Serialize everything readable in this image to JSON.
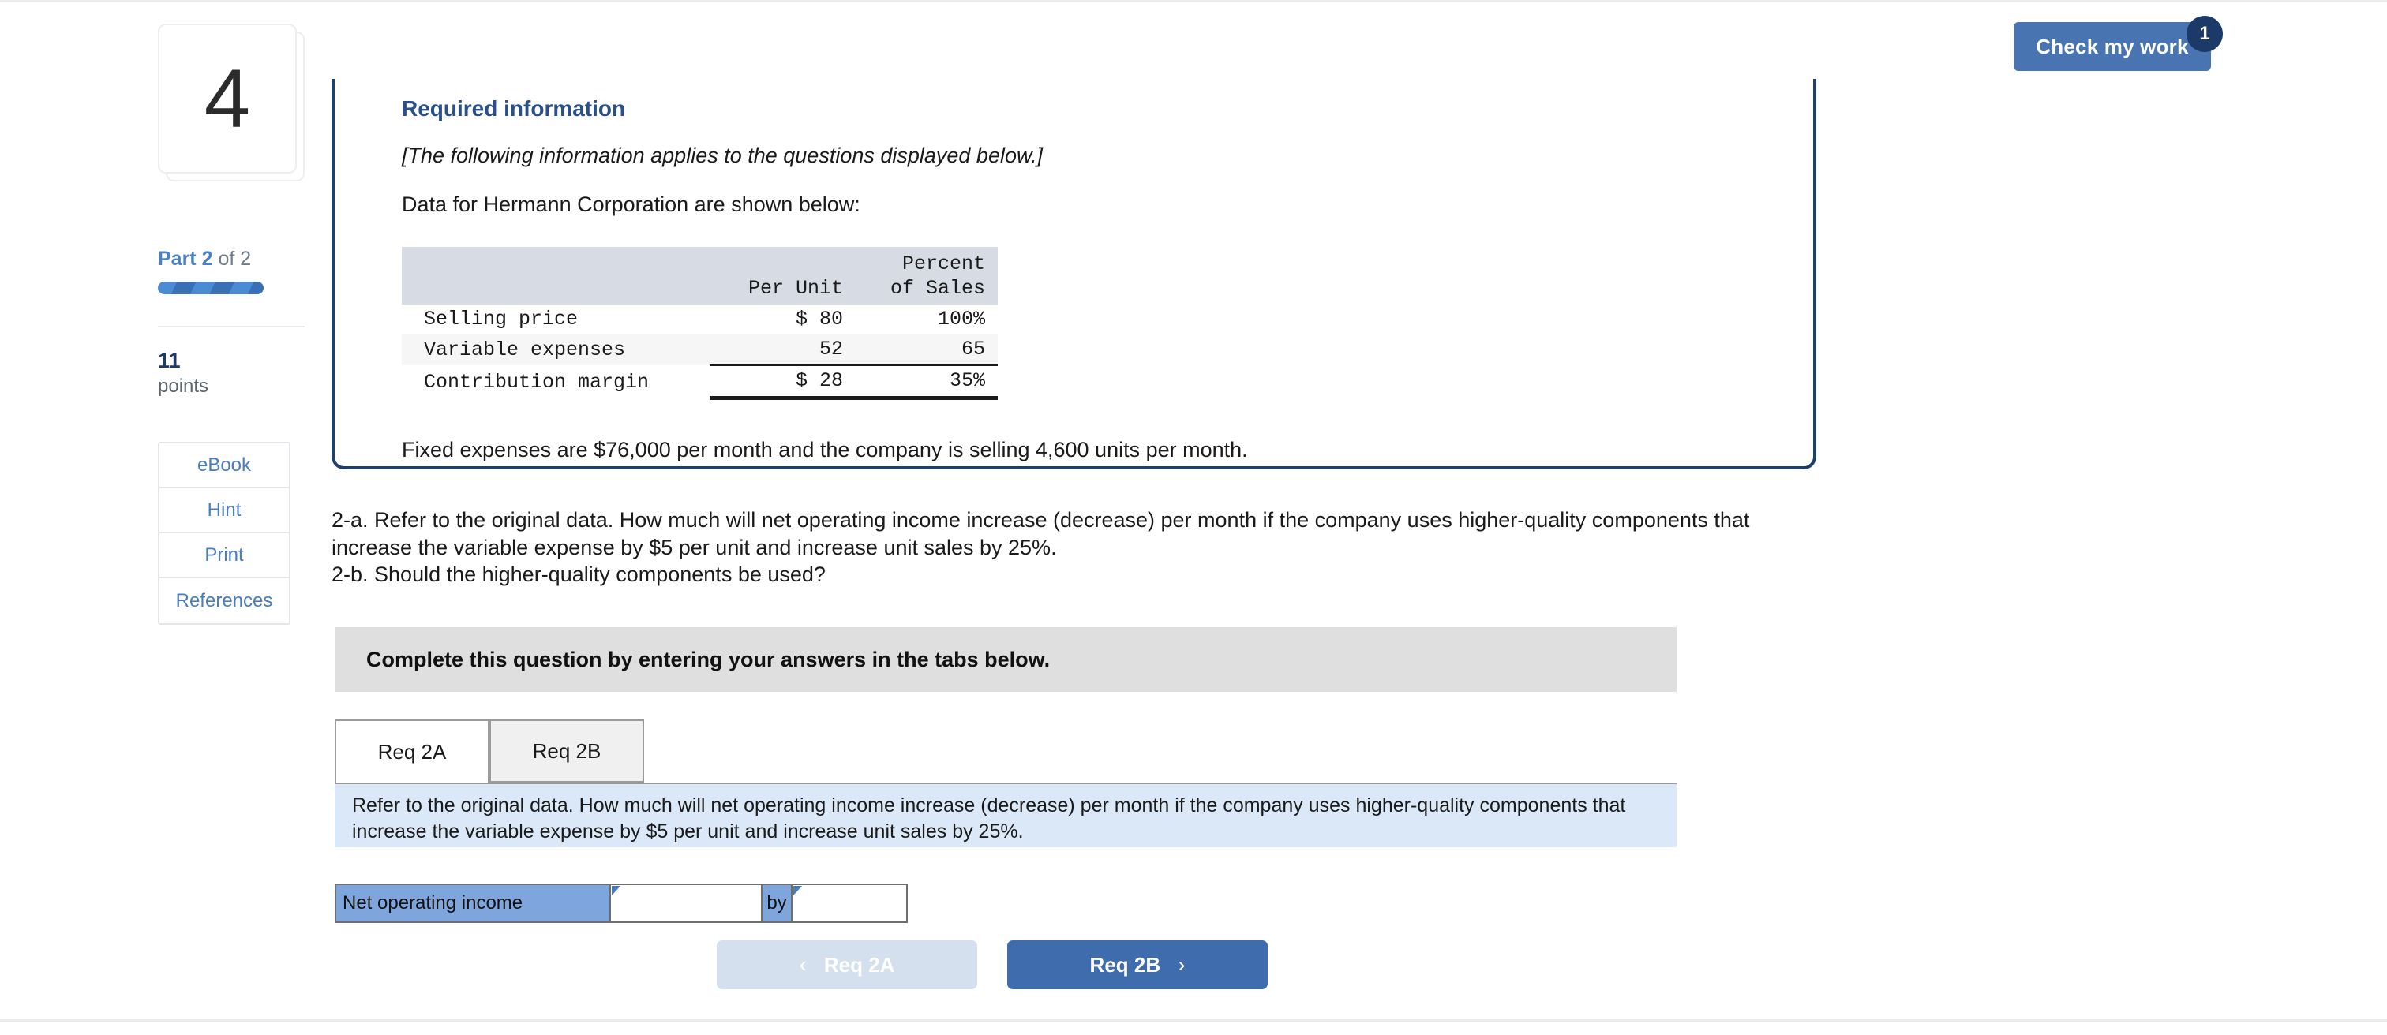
{
  "header": {
    "check_my_work_label": "Check my work",
    "check_my_work_badge": "1"
  },
  "sidebar": {
    "question_number": "4",
    "part_prefix": "Part ",
    "part_current": "2",
    "part_suffix": " of 2",
    "points_value": "11",
    "points_label": "points",
    "tools": [
      {
        "label": "eBook"
      },
      {
        "label": "Hint"
      },
      {
        "label": "Print"
      },
      {
        "label": "References"
      }
    ]
  },
  "required_info": {
    "title": "Required information",
    "italic_note": "[The following information applies to the questions displayed below.]",
    "data_intro": "Data for Hermann Corporation are shown below:",
    "fixed_expenses": "Fixed expenses are $76,000 per month and the company is selling 4,600 units per month."
  },
  "table": {
    "header_line1_col2": "",
    "header_line1_col3": "Percent",
    "header_line2_col1": "",
    "header_line2_col2": "Per Unit",
    "header_line2_col3": "of Sales",
    "rows": [
      {
        "label": "Selling price",
        "per_unit": "$ 80",
        "percent": "100%"
      },
      {
        "label": "Variable expenses",
        "per_unit": "52",
        "percent": "65"
      },
      {
        "label": "Contribution margin",
        "per_unit": "$ 28",
        "percent": "35%"
      }
    ]
  },
  "question": {
    "line_2a": "2-a. Refer to the original data. How much will net operating income increase (decrease) per month if the company uses higher-quality components that increase the variable expense by $5 per unit and increase unit sales by 25%.",
    "line_2b": "2-b. Should the higher-quality components be used?"
  },
  "instruction": {
    "text": "Complete this question by entering your answers in the tabs below."
  },
  "tabs": [
    {
      "label": "Req 2A",
      "active": true
    },
    {
      "label": "Req 2B",
      "active": false
    }
  ],
  "info_panel": {
    "text": "Refer to the original data. How much will net operating income increase (decrease) per month if the company uses higher-quality components that increase the variable expense by $5 per unit and increase unit sales by 25%."
  },
  "answer_row": {
    "label": "Net operating income",
    "value_1": "",
    "connector": "by",
    "value_2": ""
  },
  "nav": {
    "prev_label": "Req 2A",
    "prev_icon": "chevron-left",
    "prev_glyph": "‹",
    "next_label": "Req 2B",
    "next_icon": "chevron-right",
    "next_glyph": "›"
  },
  "colors": {
    "brand_blue": "#4874b1",
    "deep_navy": "#1b3a68",
    "box_border": "#1f3f6e",
    "info_panel_bg": "#dae8f7",
    "instruction_bg": "#dfdfdf",
    "answer_cell_bg": "#7ea6dc",
    "table_header_bg": "#d7dbe4",
    "next_button_bg": "#3e6cac",
    "prev_button_bg": "#d4e0ee"
  }
}
